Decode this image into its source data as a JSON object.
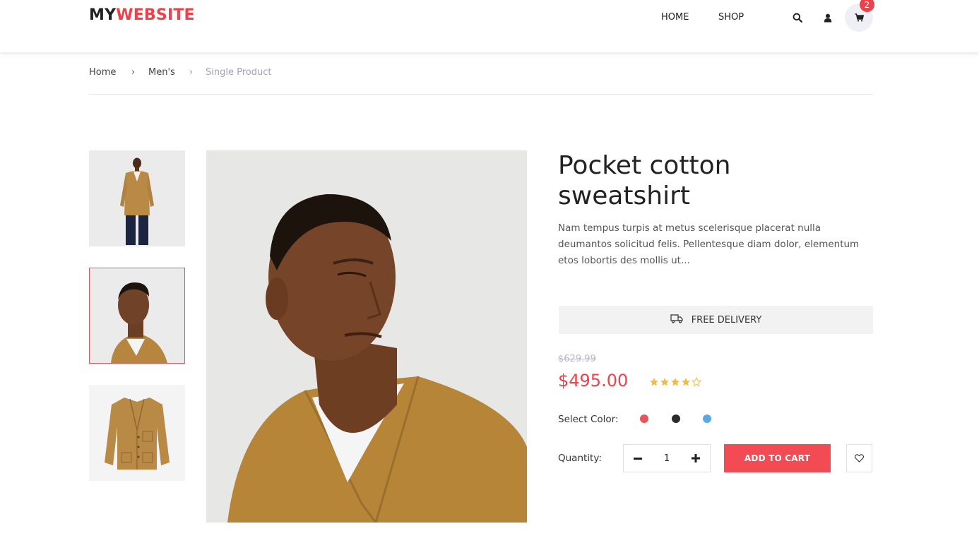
{
  "brand": {
    "part1": "MY",
    "part2": "WEBSITE"
  },
  "nav": {
    "home": "HOME",
    "shop": "SHOP"
  },
  "icons": {
    "search": "search-icon",
    "user": "user-icon",
    "cart": "cart-icon",
    "delivery": "truck-icon",
    "wishlist": "heart-icon"
  },
  "cart": {
    "count": "2"
  },
  "breadcrumb": {
    "home": "Home",
    "sep": "›",
    "mens": "Men's",
    "current": "Single Product"
  },
  "product": {
    "title": "Pocket cotton sweatshirt",
    "description": "Nam tempus turpis at metus scelerisque placerat nulla deumantos solicitud felis. Pellentesque diam dolor, elementum etos lobortis des mollis ut...",
    "delivery": "FREE DELIVERY",
    "old_price": "$629.99",
    "price": "$495.00",
    "rating": 4,
    "rating_max": 5,
    "color_label": "Select Color:",
    "colors": [
      "#e8535c",
      "#2b2b2b",
      "#5aa8e6"
    ],
    "quantity_label": "Quantity:",
    "quantity": "1",
    "add_to_cart": "ADD TO CART"
  },
  "theme": {
    "accent": "#f0414b",
    "star": "#f5b942"
  }
}
